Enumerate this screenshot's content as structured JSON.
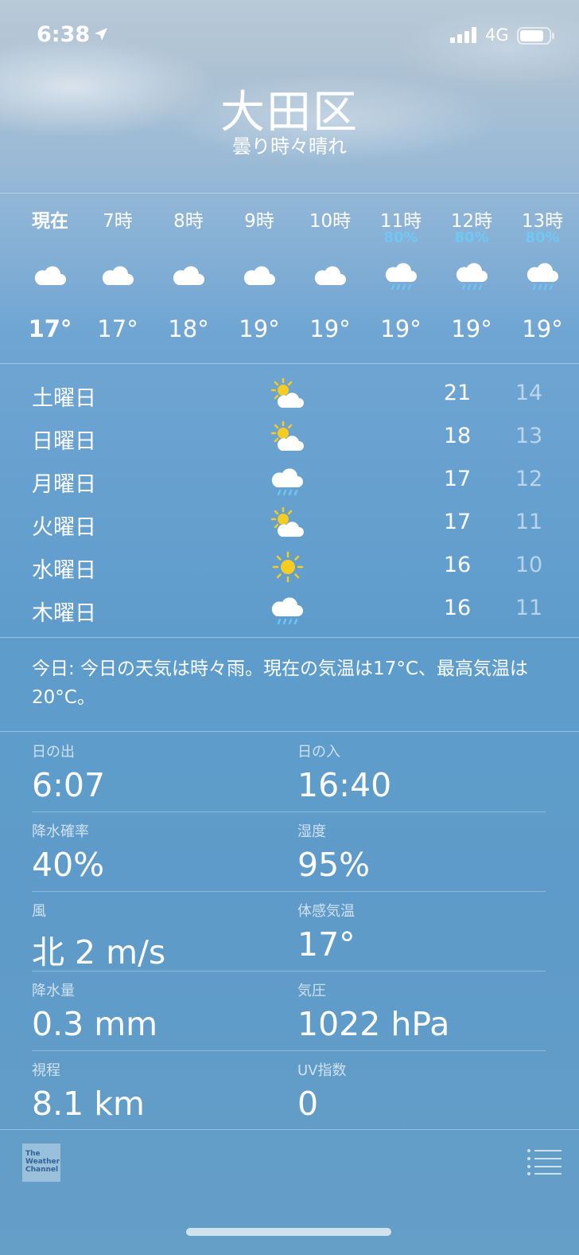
{
  "status_bar": {
    "time": "6:38",
    "network": "4G"
  },
  "location": {
    "city": "大田区",
    "condition": "曇り時々晴れ"
  },
  "hourly": [
    {
      "label": "現在",
      "precip": "",
      "icon": "cloud-icon",
      "temp": "17°"
    },
    {
      "label": "7時",
      "precip": "",
      "icon": "cloud-icon",
      "temp": "17°"
    },
    {
      "label": "8時",
      "precip": "",
      "icon": "cloud-icon",
      "temp": "18°"
    },
    {
      "label": "9時",
      "precip": "",
      "icon": "cloud-icon",
      "temp": "19°"
    },
    {
      "label": "10時",
      "precip": "",
      "icon": "cloud-icon",
      "temp": "19°"
    },
    {
      "label": "11時",
      "precip": "80%",
      "icon": "cloud-rain-icon",
      "temp": "19°"
    },
    {
      "label": "12時",
      "precip": "80%",
      "icon": "cloud-rain-icon",
      "temp": "19°"
    },
    {
      "label": "13時",
      "precip": "80%",
      "icon": "cloud-rain-icon",
      "temp": "19°"
    }
  ],
  "daily": [
    {
      "day": "土曜日",
      "icon": "partly-sunny-icon",
      "high": "21",
      "low": "14"
    },
    {
      "day": "日曜日",
      "icon": "partly-sunny-icon",
      "high": "18",
      "low": "13"
    },
    {
      "day": "月曜日",
      "icon": "cloud-rain-icon",
      "high": "17",
      "low": "12"
    },
    {
      "day": "火曜日",
      "icon": "partly-sunny-icon",
      "high": "17",
      "low": "11"
    },
    {
      "day": "水曜日",
      "icon": "sun-icon",
      "high": "16",
      "low": "10"
    },
    {
      "day": "木曜日",
      "icon": "cloud-rain-icon",
      "high": "16",
      "low": "11"
    }
  ],
  "summary": "今日: 今日の天気は時々雨。現在の気温は17°C、最高気温は20°C。",
  "details": [
    {
      "label1": "日の出",
      "value1": "6:07",
      "label2": "日の入",
      "value2": "16:40"
    },
    {
      "label1": "降水確率",
      "value1": "40%",
      "label2": "湿度",
      "value2": "95%"
    },
    {
      "label1": "風",
      "value1": "北 2 m/s",
      "label2": "体感気温",
      "value2": "17°"
    },
    {
      "label1": "降水量",
      "value1": "0.3 mm",
      "label2": "気圧",
      "value2": "1022 hPa"
    },
    {
      "label1": "視程",
      "value1": "8.1 km",
      "label2": "UV指数",
      "value2": "0"
    }
  ],
  "footer": {
    "provider": "The Weather Channel"
  },
  "colors": {
    "sun": "#f5cc1f",
    "precip": "#70c8f5",
    "rain": "#6cc4f2"
  }
}
